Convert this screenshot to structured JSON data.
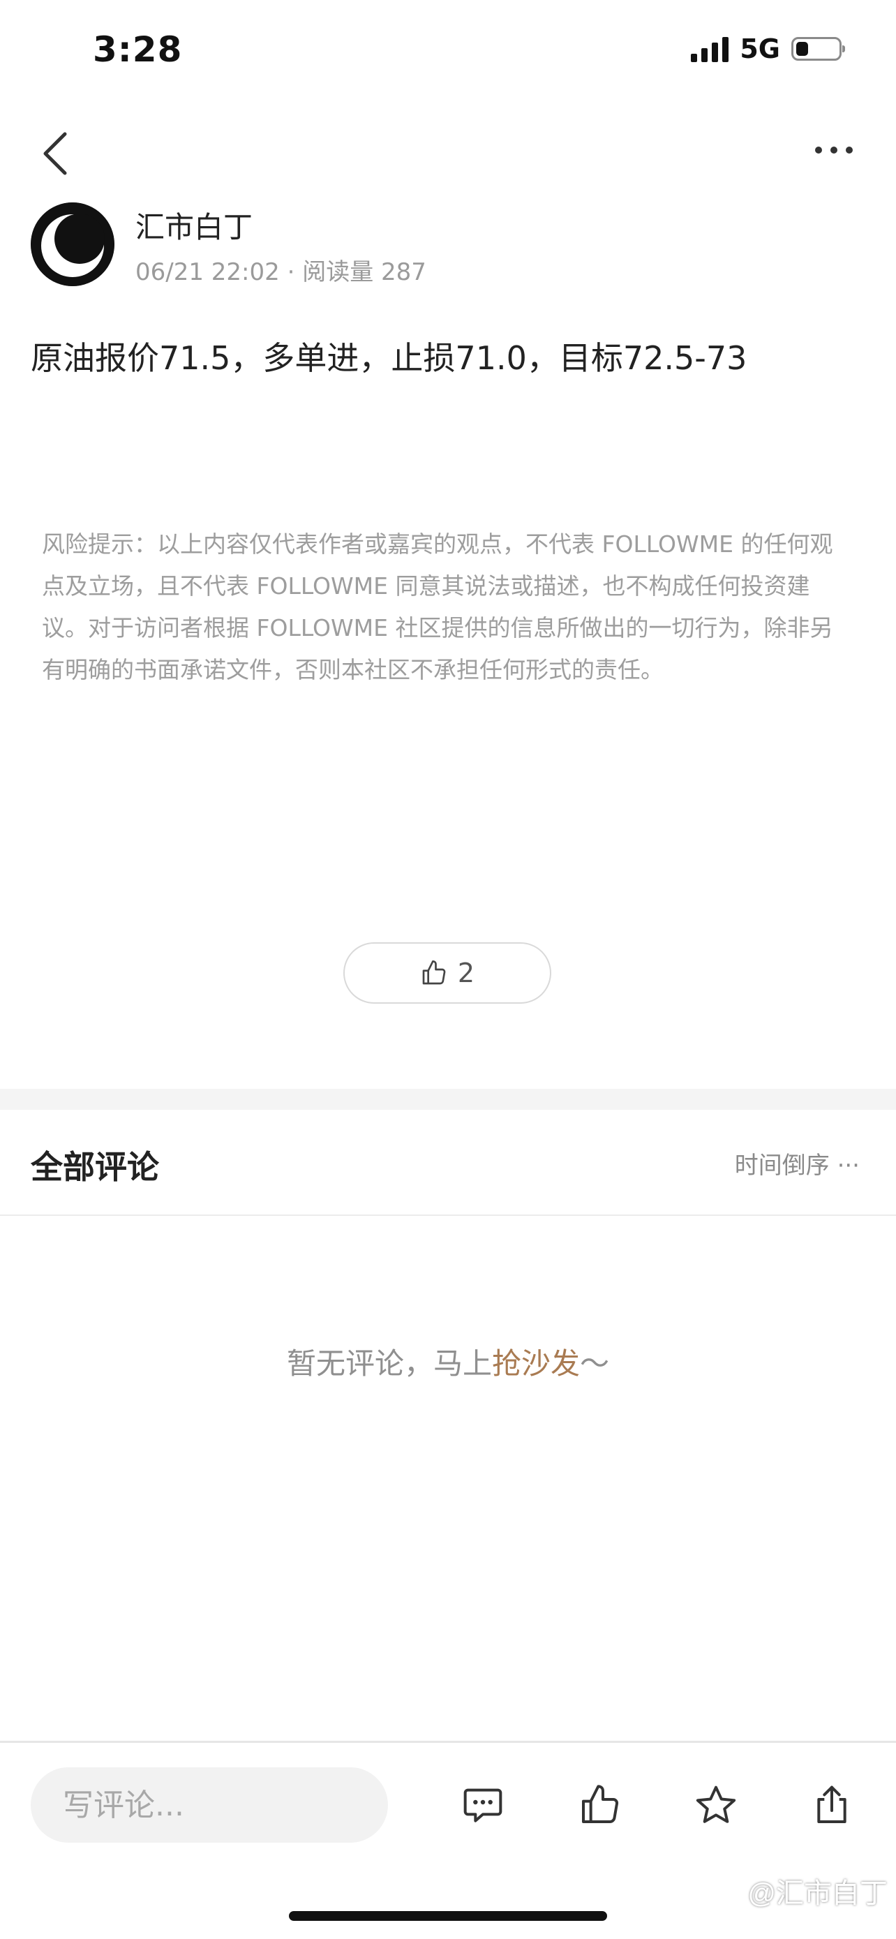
{
  "status_bar": {
    "time": "3:28",
    "network": "5G",
    "battery_level": 0.3
  },
  "nav": {
    "back_icon": "chevron-left-icon",
    "more_icon": "more-horizontal-icon"
  },
  "author": {
    "name": "汇市白丁",
    "date": "06/21 22:02",
    "separator": "·",
    "read_label": "阅读量",
    "read_count": "287"
  },
  "post": {
    "content": "原油报价71.5，多单进，止损71.0，目标72.5-73"
  },
  "disclaimer": "风险提示：以上内容仅代表作者或嘉宾的观点，不代表 FOLLOWME 的任何观点及立场，且不代表 FOLLOWME 同意其说法或描述，也不构成任何投资建议。对于访问者根据 FOLLOWME 社区提供的信息所做出的一切行为，除非另有明确的书面承诺文件，否则本社区不承担任何形式的责任。",
  "like": {
    "icon": "thumbs-up-icon",
    "count": "2"
  },
  "comments": {
    "title": "全部评论",
    "sort_label": "时间倒序",
    "sort_more": "···",
    "empty_text": "暂无评论，马上",
    "empty_link": "抢沙发",
    "empty_suffix": "～"
  },
  "bottom_bar": {
    "input_placeholder": "写评论...",
    "icons": [
      "comment-icon",
      "thumbs-up-icon",
      "star-icon",
      "share-icon"
    ]
  },
  "watermark": "@汇市白丁",
  "colors": {
    "accent_link": "#a97b52",
    "muted_text": "#9a9a9a",
    "section_gap": "#f4f4f4"
  }
}
